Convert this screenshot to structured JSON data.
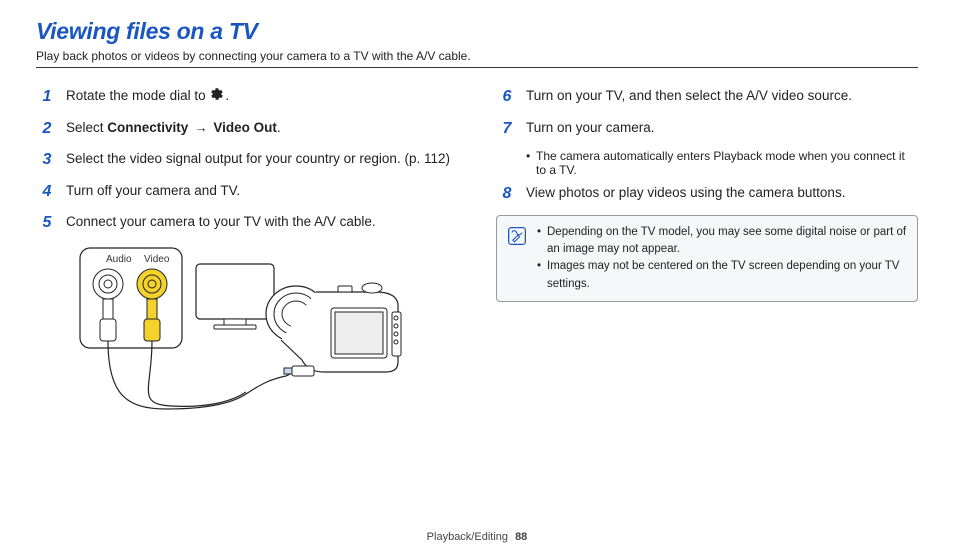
{
  "title": "Viewing files on a TV",
  "subtitle": "Play back photos or videos by connecting your camera to a TV with the A/V cable.",
  "steps_left": [
    {
      "num": "1",
      "prefix": "Rotate the mode dial to ",
      "icon": "gear",
      "suffix": "."
    },
    {
      "num": "2",
      "prefix": "Select ",
      "bold1": "Connectivity",
      "arrow": " → ",
      "bold2": "Video Out",
      "suffix": "."
    },
    {
      "num": "3",
      "text": "Select the video signal output for your country or region. (p. 112)"
    },
    {
      "num": "4",
      "text": "Turn off your camera and TV."
    },
    {
      "num": "5",
      "text": "Connect your camera to your TV with the A/V cable."
    }
  ],
  "steps_right": [
    {
      "num": "6",
      "text": "Turn on your TV, and then select the A/V video source."
    },
    {
      "num": "7",
      "text": "Turn on your camera.",
      "sub": [
        "The camera automatically enters Playback mode when you connect it to a TV."
      ]
    },
    {
      "num": "8",
      "text": "View photos or play videos using the camera buttons."
    }
  ],
  "diagram": {
    "audio_label": "Audio",
    "video_label": "Video"
  },
  "notebox": [
    "Depending on the TV model, you may see some digital noise or part of an image may not appear.",
    "Images may not be centered on the TV screen depending on your TV settings."
  ],
  "footer": {
    "section": "Playback/Editing",
    "page": "88"
  }
}
